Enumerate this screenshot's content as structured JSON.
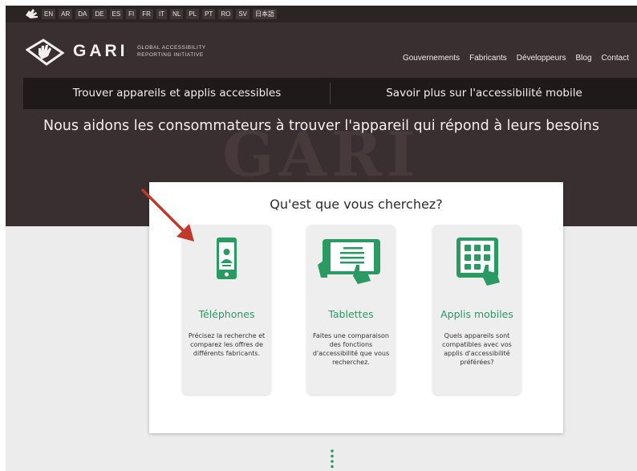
{
  "languages": [
    "EN",
    "AR",
    "DA",
    "DE",
    "ES",
    "FI",
    "FR",
    "IT",
    "NL",
    "PL",
    "PT",
    "RO",
    "SV",
    "日本語"
  ],
  "brand": {
    "name": "GARI",
    "subtitle_line1": "Global Accessibility",
    "subtitle_line2": "Reporting Initiative",
    "watermark": "GARI"
  },
  "main_nav": [
    "Gouvernements",
    "Fabricants",
    "Développeurs",
    "Blog",
    "Contact"
  ],
  "nav_bar": {
    "find": "Trouver appareils et applis accessibles",
    "learn": "Savoir plus sur l'accessibilité mobile"
  },
  "tagline": "Nous aidons les consommateurs à trouver l'appareil qui répond à leurs besoins",
  "card": {
    "title": "Qu'est que vous cherchez?",
    "options": [
      {
        "title": "Téléphones",
        "icon": "phone-icon",
        "description": "Précisez la recherche et comparez les offres de différents fabricants."
      },
      {
        "title": "Tablettes",
        "icon": "tablet-icon",
        "description": "Faites une comparaison des fonctions d'accessibilité que vous recherchez."
      },
      {
        "title": "Applis mobiles",
        "icon": "apps-icon",
        "description": "Quels appareils sont compatibles avec vos applis d'accessibilité préférées?"
      }
    ]
  },
  "colors": {
    "header_bg": "#3a2f30",
    "nav_bar_bg": "#1f1919",
    "accent_green": "#2a9a63",
    "arrow_red": "#c0392b"
  }
}
